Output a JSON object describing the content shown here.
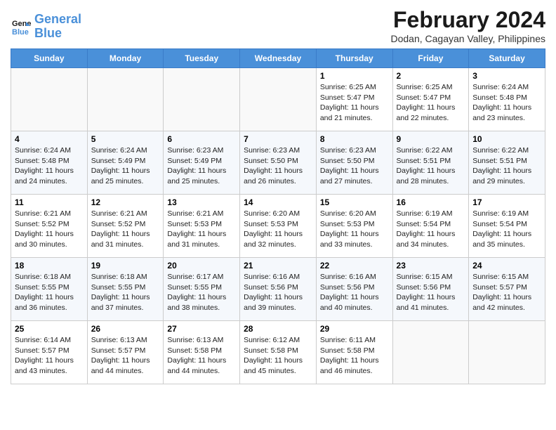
{
  "header": {
    "logo_line1": "General",
    "logo_line2": "Blue",
    "title": "February 2024",
    "subtitle": "Dodan, Cagayan Valley, Philippines"
  },
  "days_of_week": [
    "Sunday",
    "Monday",
    "Tuesday",
    "Wednesday",
    "Thursday",
    "Friday",
    "Saturday"
  ],
  "weeks": [
    [
      {
        "date": "",
        "info": ""
      },
      {
        "date": "",
        "info": ""
      },
      {
        "date": "",
        "info": ""
      },
      {
        "date": "",
        "info": ""
      },
      {
        "date": "1",
        "info": "Sunrise: 6:25 AM\nSunset: 5:47 PM\nDaylight: 11 hours\nand 21 minutes."
      },
      {
        "date": "2",
        "info": "Sunrise: 6:25 AM\nSunset: 5:47 PM\nDaylight: 11 hours\nand 22 minutes."
      },
      {
        "date": "3",
        "info": "Sunrise: 6:24 AM\nSunset: 5:48 PM\nDaylight: 11 hours\nand 23 minutes."
      }
    ],
    [
      {
        "date": "4",
        "info": "Sunrise: 6:24 AM\nSunset: 5:48 PM\nDaylight: 11 hours\nand 24 minutes."
      },
      {
        "date": "5",
        "info": "Sunrise: 6:24 AM\nSunset: 5:49 PM\nDaylight: 11 hours\nand 25 minutes."
      },
      {
        "date": "6",
        "info": "Sunrise: 6:23 AM\nSunset: 5:49 PM\nDaylight: 11 hours\nand 25 minutes."
      },
      {
        "date": "7",
        "info": "Sunrise: 6:23 AM\nSunset: 5:50 PM\nDaylight: 11 hours\nand 26 minutes."
      },
      {
        "date": "8",
        "info": "Sunrise: 6:23 AM\nSunset: 5:50 PM\nDaylight: 11 hours\nand 27 minutes."
      },
      {
        "date": "9",
        "info": "Sunrise: 6:22 AM\nSunset: 5:51 PM\nDaylight: 11 hours\nand 28 minutes."
      },
      {
        "date": "10",
        "info": "Sunrise: 6:22 AM\nSunset: 5:51 PM\nDaylight: 11 hours\nand 29 minutes."
      }
    ],
    [
      {
        "date": "11",
        "info": "Sunrise: 6:21 AM\nSunset: 5:52 PM\nDaylight: 11 hours\nand 30 minutes."
      },
      {
        "date": "12",
        "info": "Sunrise: 6:21 AM\nSunset: 5:52 PM\nDaylight: 11 hours\nand 31 minutes."
      },
      {
        "date": "13",
        "info": "Sunrise: 6:21 AM\nSunset: 5:53 PM\nDaylight: 11 hours\nand 31 minutes."
      },
      {
        "date": "14",
        "info": "Sunrise: 6:20 AM\nSunset: 5:53 PM\nDaylight: 11 hours\nand 32 minutes."
      },
      {
        "date": "15",
        "info": "Sunrise: 6:20 AM\nSunset: 5:53 PM\nDaylight: 11 hours\nand 33 minutes."
      },
      {
        "date": "16",
        "info": "Sunrise: 6:19 AM\nSunset: 5:54 PM\nDaylight: 11 hours\nand 34 minutes."
      },
      {
        "date": "17",
        "info": "Sunrise: 6:19 AM\nSunset: 5:54 PM\nDaylight: 11 hours\nand 35 minutes."
      }
    ],
    [
      {
        "date": "18",
        "info": "Sunrise: 6:18 AM\nSunset: 5:55 PM\nDaylight: 11 hours\nand 36 minutes."
      },
      {
        "date": "19",
        "info": "Sunrise: 6:18 AM\nSunset: 5:55 PM\nDaylight: 11 hours\nand 37 minutes."
      },
      {
        "date": "20",
        "info": "Sunrise: 6:17 AM\nSunset: 5:55 PM\nDaylight: 11 hours\nand 38 minutes."
      },
      {
        "date": "21",
        "info": "Sunrise: 6:16 AM\nSunset: 5:56 PM\nDaylight: 11 hours\nand 39 minutes."
      },
      {
        "date": "22",
        "info": "Sunrise: 6:16 AM\nSunset: 5:56 PM\nDaylight: 11 hours\nand 40 minutes."
      },
      {
        "date": "23",
        "info": "Sunrise: 6:15 AM\nSunset: 5:56 PM\nDaylight: 11 hours\nand 41 minutes."
      },
      {
        "date": "24",
        "info": "Sunrise: 6:15 AM\nSunset: 5:57 PM\nDaylight: 11 hours\nand 42 minutes."
      }
    ],
    [
      {
        "date": "25",
        "info": "Sunrise: 6:14 AM\nSunset: 5:57 PM\nDaylight: 11 hours\nand 43 minutes."
      },
      {
        "date": "26",
        "info": "Sunrise: 6:13 AM\nSunset: 5:57 PM\nDaylight: 11 hours\nand 44 minutes."
      },
      {
        "date": "27",
        "info": "Sunrise: 6:13 AM\nSunset: 5:58 PM\nDaylight: 11 hours\nand 44 minutes."
      },
      {
        "date": "28",
        "info": "Sunrise: 6:12 AM\nSunset: 5:58 PM\nDaylight: 11 hours\nand 45 minutes."
      },
      {
        "date": "29",
        "info": "Sunrise: 6:11 AM\nSunset: 5:58 PM\nDaylight: 11 hours\nand 46 minutes."
      },
      {
        "date": "",
        "info": ""
      },
      {
        "date": "",
        "info": ""
      }
    ]
  ]
}
